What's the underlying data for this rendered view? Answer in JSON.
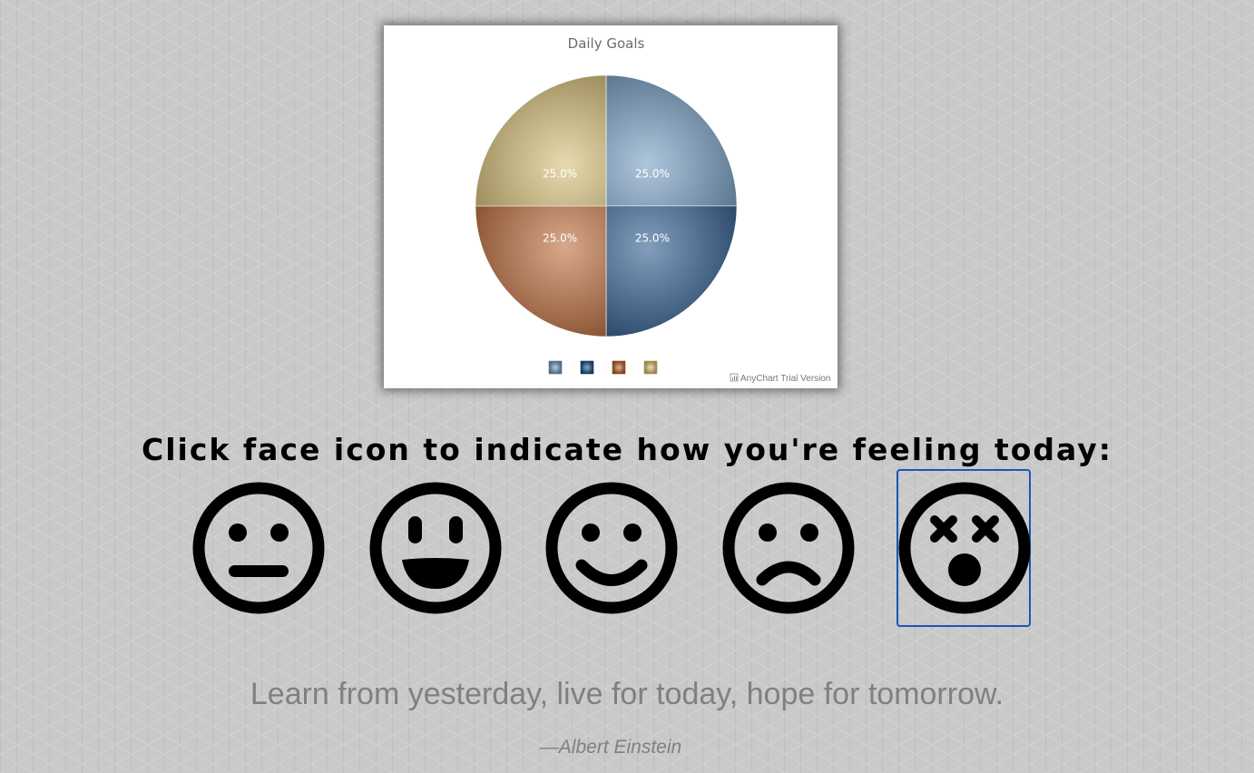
{
  "chart_data": {
    "type": "pie",
    "title": "Daily Goals",
    "categories": [
      "",
      "",
      "",
      ""
    ],
    "values": [
      25,
      25,
      25,
      25
    ],
    "labels": [
      "25.0%",
      "25.0%",
      "25.0%",
      "25.0%"
    ],
    "colors": [
      "#6b97bf",
      "#1d4f86",
      "#b6602a",
      "#d6bb6e"
    ],
    "legend_placement": "bottom",
    "credit": "AnyChart Trial Version"
  },
  "prompt": {
    "heading": "Click face icon to indicate how you're feeling today:"
  },
  "faces": [
    {
      "mood": "neutral",
      "icon": "neutral-face-icon",
      "selected": false
    },
    {
      "mood": "grinning",
      "icon": "grinning-face-icon",
      "selected": false
    },
    {
      "mood": "smiling",
      "icon": "smiling-face-icon",
      "selected": false
    },
    {
      "mood": "frowning",
      "icon": "frowning-face-icon",
      "selected": false
    },
    {
      "mood": "dizzy",
      "icon": "dizzy-face-icon",
      "selected": true
    }
  ],
  "quote": {
    "text": "Learn from yesterday, live for today, hope for tomorrow.",
    "author": "—Albert Einstein"
  },
  "colors": {
    "selection_border": "#1a56b8",
    "quote_text": "#808080"
  }
}
